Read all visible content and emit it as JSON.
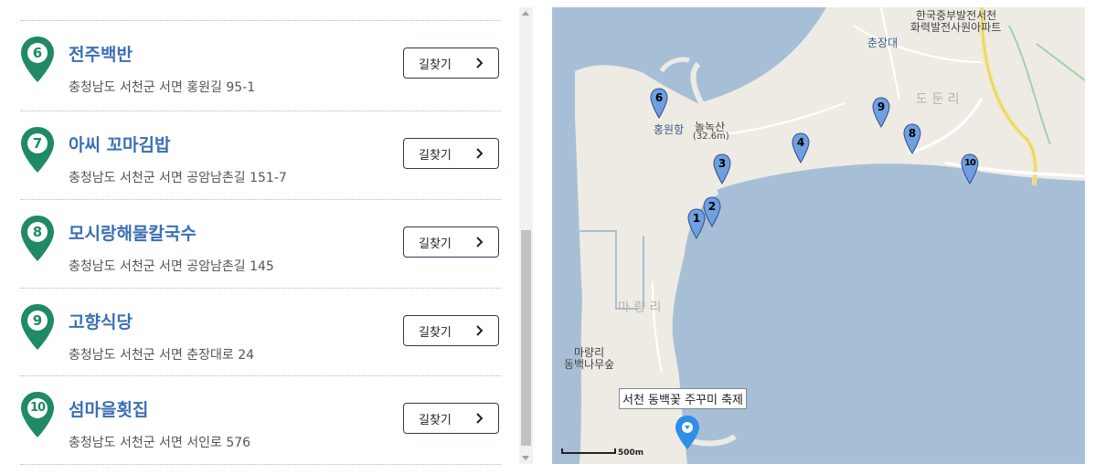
{
  "places": [
    {
      "num": "6",
      "name": "전주백반",
      "address": "충청남도 서천군 서면 홍원길 95-1",
      "route_label": "길찾기"
    },
    {
      "num": "7",
      "name": "아씨 꼬마김밥",
      "address": "충청남도 서천군 서면 공암남촌길 151-7",
      "route_label": "길찾기"
    },
    {
      "num": "8",
      "name": "모시랑해물칼국수",
      "address": "충청남도 서천군 서면 공암남촌길 145",
      "route_label": "길찾기"
    },
    {
      "num": "9",
      "name": "고향식당",
      "address": "충청남도 서천군 서면 춘장대로 24",
      "route_label": "길찾기"
    },
    {
      "num": "10",
      "name": "섬마을횟집",
      "address": "충청남도 서천군 서면 서인로 576",
      "route_label": "길찾기"
    }
  ],
  "map": {
    "labels": {
      "plant_1": "한국중부발전서천",
      "plant_2": "화력발전사원아파트",
      "beach": "춘장대",
      "mountain": "놀녹산",
      "mountain_height": "(32.6m)",
      "port": "홍원항",
      "village_dodun": "도 둔 리",
      "village_maryang": "마 량 리",
      "camellia_1": "마량리",
      "camellia_2": "동백나무숲"
    },
    "markers": [
      "1",
      "2",
      "3",
      "4",
      "6",
      "8",
      "9",
      "10"
    ],
    "event_label": "서천 동백꽃 주꾸미 축제",
    "scale_label": "500m",
    "colors": {
      "sea": "#a7bfd6",
      "land": "#eeebe4",
      "pin_green": "#1f8a63",
      "marker_blue": "#6f9fe0",
      "event_pin": "#2f8ee6"
    }
  }
}
